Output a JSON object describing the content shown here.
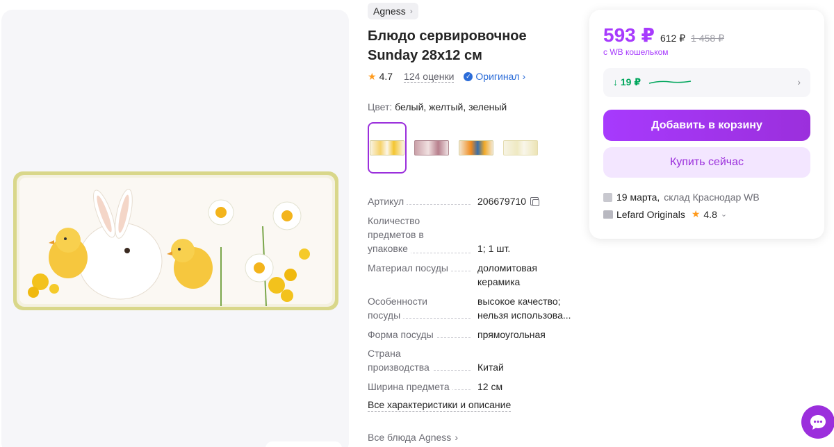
{
  "brand": {
    "label": "Agness"
  },
  "product": {
    "title": "Блюдо сервировочное Sunday 28x12 см",
    "rating": "4.7",
    "reviews": "124 оценки",
    "original_label": "Оригинал",
    "color_label": "Цвет:",
    "color_value": "белый, желтый, зеленый"
  },
  "specs": [
    {
      "key": "Артикул",
      "value": "206679710"
    },
    {
      "key": "Количество предметов в упаковке",
      "value": "1; 1 шт."
    },
    {
      "key": "Материал посуды",
      "value": "доломитовая керамика"
    },
    {
      "key": "Особенности посуды",
      "value": "высокое качество; нельзя использова..."
    },
    {
      "key": "Форма посуды",
      "value": "прямоугольная"
    },
    {
      "key": "Страна производства",
      "value": "Китай"
    },
    {
      "key": "Ширина предмета",
      "value": "12 см"
    }
  ],
  "links": {
    "all_specs": "Все характеристики и описание",
    "all_dishes": "Все блюда Agness"
  },
  "price": {
    "current": "593 ₽",
    "old": "612 ₽",
    "strike": "1 458 ₽",
    "wallet_note": "с WB кошельком",
    "history_delta": "↓ 19 ₽"
  },
  "buttons": {
    "add_to_cart": "Добавить в корзину",
    "buy_now": "Купить сейчас"
  },
  "delivery": {
    "date": "19 марта,",
    "warehouse": "склад Краснодар WB"
  },
  "seller": {
    "name": "Lefard Originals",
    "rating": "4.8"
  },
  "colors": {
    "accent": "#9b2fdc",
    "price": "#a73afd",
    "green": "#00a65c"
  }
}
